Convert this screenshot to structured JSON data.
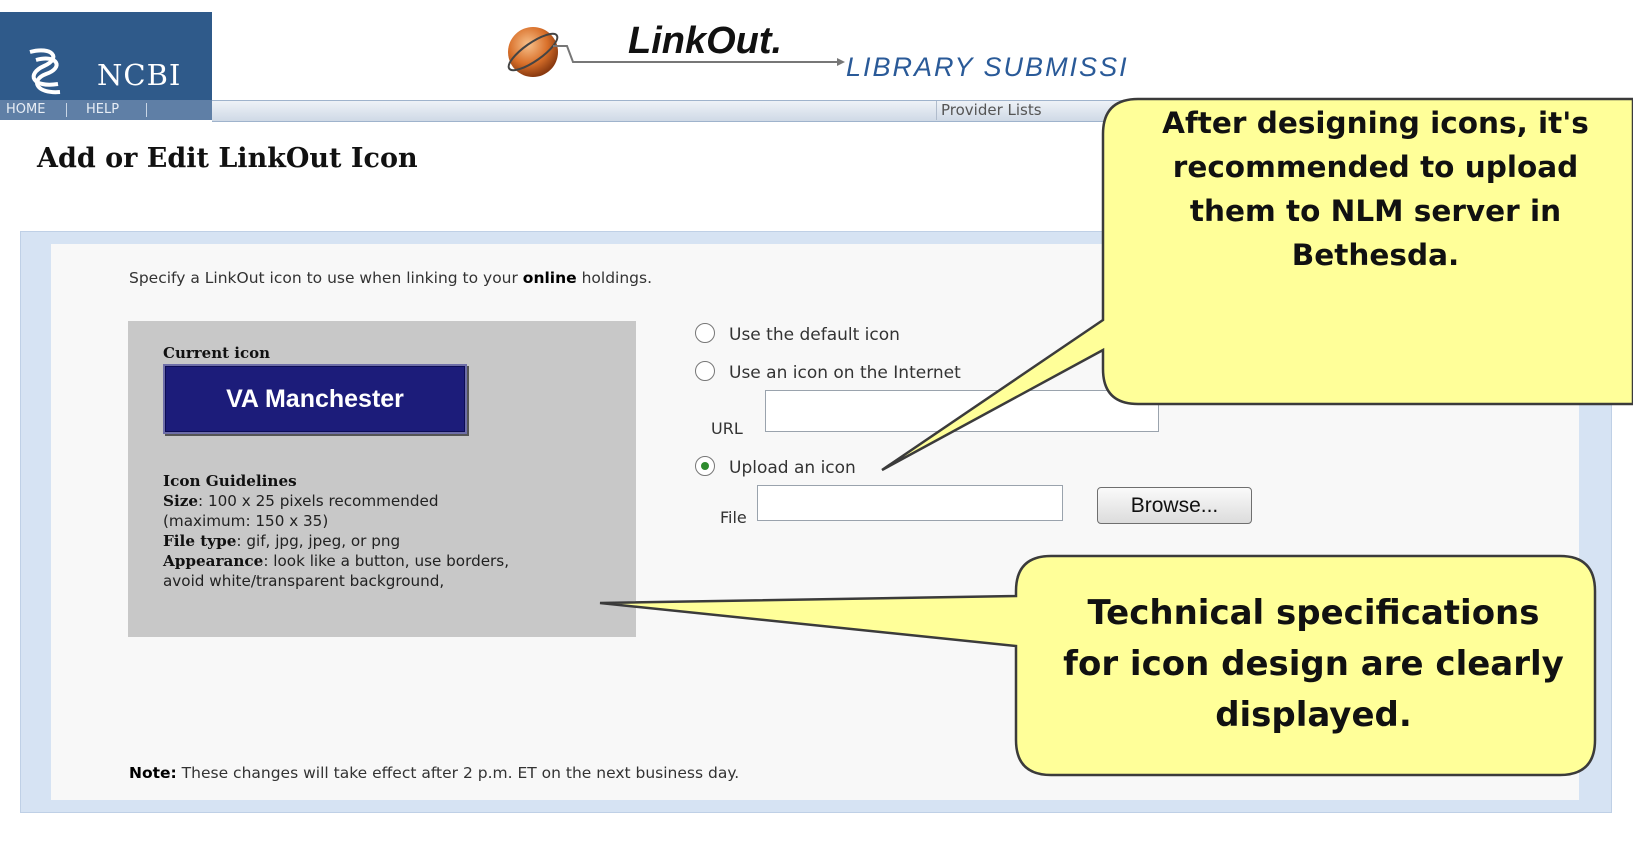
{
  "header": {
    "logo_text": "NCBI",
    "nav": [
      "HOME",
      "HELP"
    ],
    "app_title": "LinkOut.",
    "app_subtitle": "LIBRARY SUBMISSI",
    "provider_lists": "Provider Lists"
  },
  "page": {
    "title": "Add or Edit LinkOut Icon",
    "intro_prefix": "Specify a LinkOut icon to use when linking to your ",
    "intro_bold": "online",
    "intro_suffix": " holdings."
  },
  "current_icon": {
    "label": "Current icon",
    "button_text": "VA Manchester"
  },
  "guidelines": {
    "heading": "Icon Guidelines",
    "size_label": "Size",
    "size_value": ": 100 x 25 pixels recommended",
    "size_max": "(maximum: 150 x 35)",
    "filetype_label": "File type",
    "filetype_value": ": gif, jpg, jpeg, or png",
    "appearance_label": "Appearance",
    "appearance_value": ": look like a button, use borders,",
    "appearance_cont": "avoid white/transparent background,"
  },
  "options": {
    "default_icon": "Use the default icon",
    "internet_icon": "Use an icon on the Internet",
    "url_label": "URL",
    "url_value": "",
    "upload_icon": "Upload an icon",
    "file_label": "File",
    "file_value": "",
    "browse_label": "Browse...",
    "selected": "upload"
  },
  "note": {
    "label": "Note:",
    "text": " These changes will take effect after 2 p.m. ET on the next business day."
  },
  "callouts": {
    "top": [
      "After designing icons, it's",
      "recommended to upload",
      "them to NLM server in",
      "Bethesda."
    ],
    "bottom": [
      "Technical specifications",
      "for icon design are clearly",
      "displayed."
    ]
  },
  "colors": {
    "callout_fill": "#ffff99",
    "callout_stroke": "#3b3b3b",
    "ncbi_blue": "#2f5a8a",
    "panel_blue": "#d6e3f3",
    "icon_navy": "#1c1c7a"
  }
}
